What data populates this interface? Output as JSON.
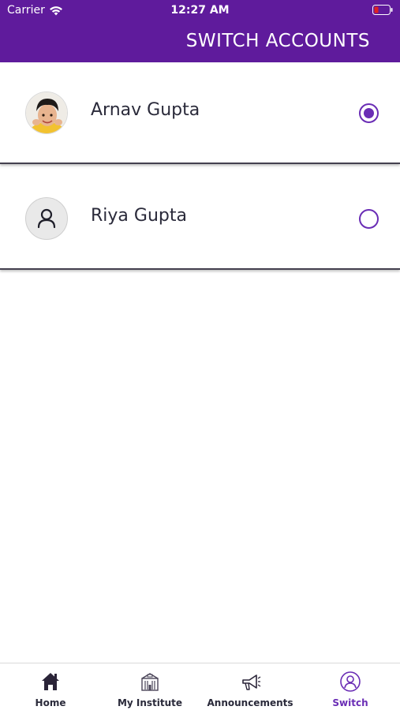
{
  "status_bar": {
    "carrier": "Carrier",
    "time": "12:27 AM"
  },
  "header": {
    "title": "SWITCH ACCOUNTS",
    "background_color": "#5f1b9c"
  },
  "accounts": [
    {
      "name": "Arnav Gupta",
      "selected": true,
      "avatar": "child-photo"
    },
    {
      "name": "Riya Gupta",
      "selected": false,
      "avatar": "person-icon"
    }
  ],
  "accent_color": "#6a2db5",
  "tab_bar": {
    "active_tab": "Switch",
    "tabs": [
      {
        "label": "Home",
        "icon": "home-icon"
      },
      {
        "label": "My Institute",
        "icon": "institute-building-icon"
      },
      {
        "label": "Announcements",
        "icon": "megaphone-icon"
      },
      {
        "label": "Switch",
        "icon": "user-circle-icon"
      }
    ]
  }
}
